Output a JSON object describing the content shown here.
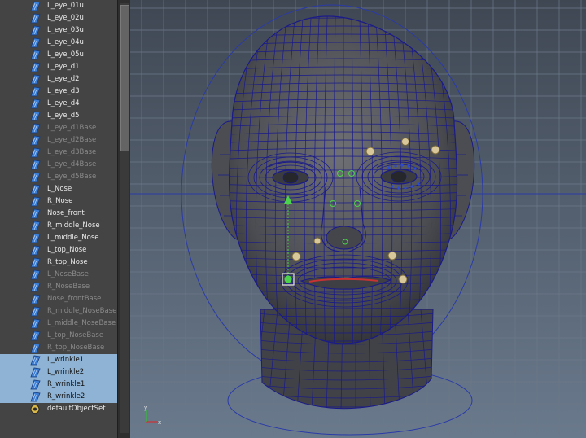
{
  "outliner": {
    "items": [
      {
        "label": "L_eye_01u",
        "state": "normal",
        "icon": "blend-shape-icon"
      },
      {
        "label": "L_eye_02u",
        "state": "normal",
        "icon": "blend-shape-icon"
      },
      {
        "label": "L_eye_03u",
        "state": "normal",
        "icon": "blend-shape-icon"
      },
      {
        "label": "L_eye_04u",
        "state": "normal",
        "icon": "blend-shape-icon"
      },
      {
        "label": "L_eye_05u",
        "state": "normal",
        "icon": "blend-shape-icon"
      },
      {
        "label": "L_eye_d1",
        "state": "normal",
        "icon": "blend-shape-icon"
      },
      {
        "label": "L_eye_d2",
        "state": "normal",
        "icon": "blend-shape-icon"
      },
      {
        "label": "L_eye_d3",
        "state": "normal",
        "icon": "blend-shape-icon"
      },
      {
        "label": "L_eye_d4",
        "state": "normal",
        "icon": "blend-shape-icon"
      },
      {
        "label": "L_eye_d5",
        "state": "normal",
        "icon": "blend-shape-icon"
      },
      {
        "label": "L_eye_d1Base",
        "state": "dim",
        "icon": "blend-shape-icon"
      },
      {
        "label": "L_eye_d2Base",
        "state": "dim",
        "icon": "blend-shape-icon"
      },
      {
        "label": "L_eye_d3Base",
        "state": "dim",
        "icon": "blend-shape-icon"
      },
      {
        "label": "L_eye_d4Base",
        "state": "dim",
        "icon": "blend-shape-icon"
      },
      {
        "label": "L_eye_d5Base",
        "state": "dim",
        "icon": "blend-shape-icon"
      },
      {
        "label": "L_Nose",
        "state": "normal",
        "icon": "blend-shape-icon"
      },
      {
        "label": "R_Nose",
        "state": "normal",
        "icon": "blend-shape-icon"
      },
      {
        "label": "Nose_front",
        "state": "normal",
        "icon": "blend-shape-icon"
      },
      {
        "label": "R_middle_Nose",
        "state": "normal",
        "icon": "blend-shape-icon"
      },
      {
        "label": "L_middle_Nose",
        "state": "normal",
        "icon": "blend-shape-icon"
      },
      {
        "label": "L_top_Nose",
        "state": "normal",
        "icon": "blend-shape-icon"
      },
      {
        "label": "R_top_Nose",
        "state": "normal",
        "icon": "blend-shape-icon"
      },
      {
        "label": "L_NoseBase",
        "state": "dim",
        "icon": "blend-shape-icon"
      },
      {
        "label": "R_NoseBase",
        "state": "dim",
        "icon": "blend-shape-icon"
      },
      {
        "label": "Nose_frontBase",
        "state": "dim",
        "icon": "blend-shape-icon"
      },
      {
        "label": "R_middle_NoseBase",
        "state": "dim",
        "icon": "blend-shape-icon"
      },
      {
        "label": "L_middle_NoseBase",
        "state": "dim",
        "icon": "blend-shape-icon"
      },
      {
        "label": "L_top_NoseBase",
        "state": "dim",
        "icon": "blend-shape-icon"
      },
      {
        "label": "R_top_NoseBase",
        "state": "dim",
        "icon": "blend-shape-icon"
      },
      {
        "label": "L_wrinkle1",
        "state": "selected",
        "icon": "blend-shape-icon"
      },
      {
        "label": "L_wrinkle2",
        "state": "selected",
        "icon": "blend-shape-icon"
      },
      {
        "label": "R_wrinkle1",
        "state": "selected",
        "icon": "blend-shape-icon"
      },
      {
        "label": "R_wrinkle2",
        "state": "selected",
        "icon": "blend-shape-icon"
      },
      {
        "label": "defaultObjectSet",
        "state": "normal",
        "icon": "object-set-icon"
      }
    ]
  },
  "viewport": {
    "axis_labels": {
      "x": "x",
      "y": "y"
    },
    "colors": {
      "background": "#4a5563",
      "grid": "#6a7686",
      "wireframe": "#1a1a8a",
      "head_fill": "#55575b",
      "controller": "#d8c79a",
      "selected_controller": "#4cd24c",
      "lip_highlight": "#c83232"
    }
  },
  "colors": {
    "outliner_bg": "#444444",
    "selection": "#8fb3d4",
    "text": "#eaeaea",
    "text_dim": "#8a8a8a"
  }
}
